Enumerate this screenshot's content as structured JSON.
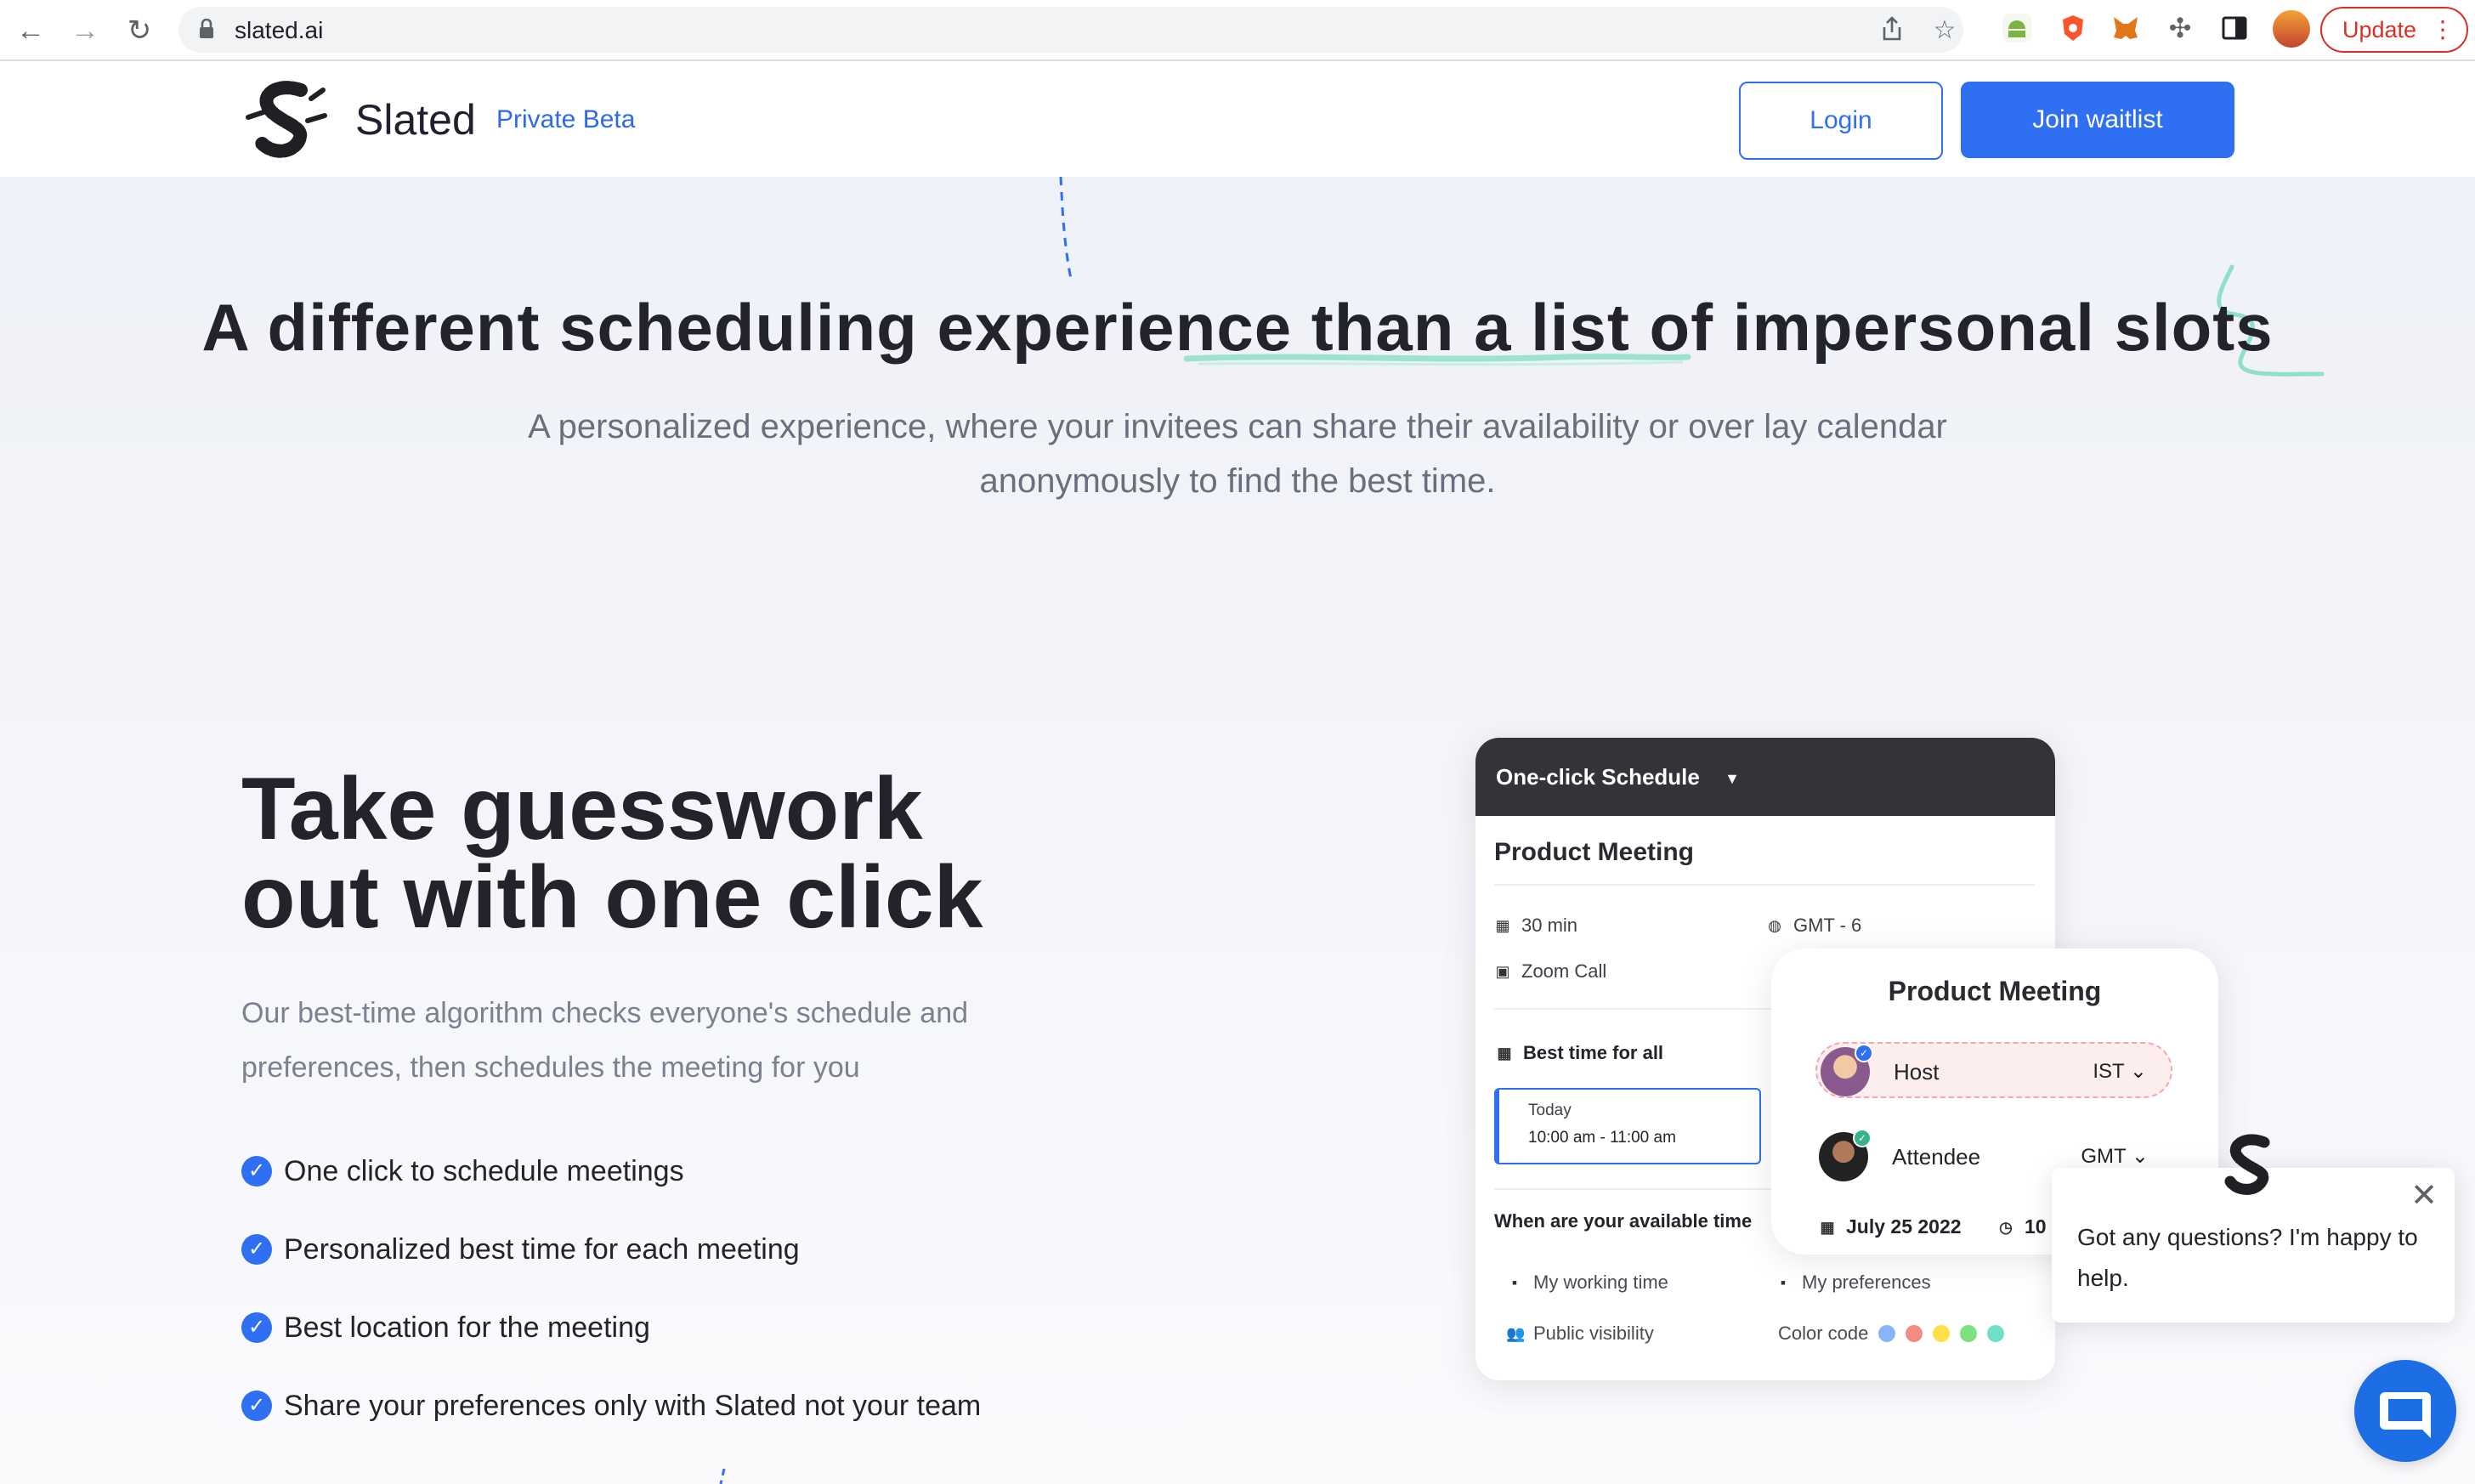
{
  "browser": {
    "url": "slated.ai",
    "update_label": "Update"
  },
  "header": {
    "brand": "Slated",
    "badge": "Private Beta",
    "login_label": "Login",
    "join_label": "Join waitlist"
  },
  "hero": {
    "title": "A different scheduling experience than a list of impersonal slots",
    "subtitle": "A personalized experience, where your invitees can share their availability or over lay calendar anonymously to find the best time."
  },
  "feature": {
    "title_line1": "Take guesswork",
    "title_line2": "out with one click",
    "subtitle": "Our best-time algorithm checks everyone's schedule and preferences, then schedules the meeting for you",
    "bullets": [
      "One click to schedule meetings",
      "Personalized best time for each meeting",
      "Best location for the meeting",
      "Share your preferences only with Slated not your team"
    ]
  },
  "schedule_card": {
    "header": "One-click Schedule",
    "meeting_title": "Product Meeting",
    "duration": "30 min",
    "timezone": "GMT - 6",
    "location": "Zoom Call",
    "best_time_label": "Best time for all",
    "slot_day": "Today",
    "slot_time": "10:00 am - 11:00 am",
    "availability_label": "When are your available time",
    "options": {
      "working_time": "My working time",
      "preferences": "My preferences",
      "visibility": "Public visibility",
      "color_code": "Color code"
    },
    "color_codes": [
      "#8ab4f8",
      "#f28b82",
      "#fde047",
      "#7ee07e",
      "#6fe0c8"
    ]
  },
  "overlay_card": {
    "title": "Product Meeting",
    "host_label": "Host",
    "host_tz": "IST",
    "attendee_label": "Attendee",
    "attendee_tz": "GMT",
    "date": "July 25 2022",
    "time_partial": "10"
  },
  "chat": {
    "message": "Got any questions? I'm happy to help."
  },
  "colors": {
    "accent": "#2f6ff2",
    "dark_header": "#333338",
    "brush_teal": "#8fe0c8"
  }
}
